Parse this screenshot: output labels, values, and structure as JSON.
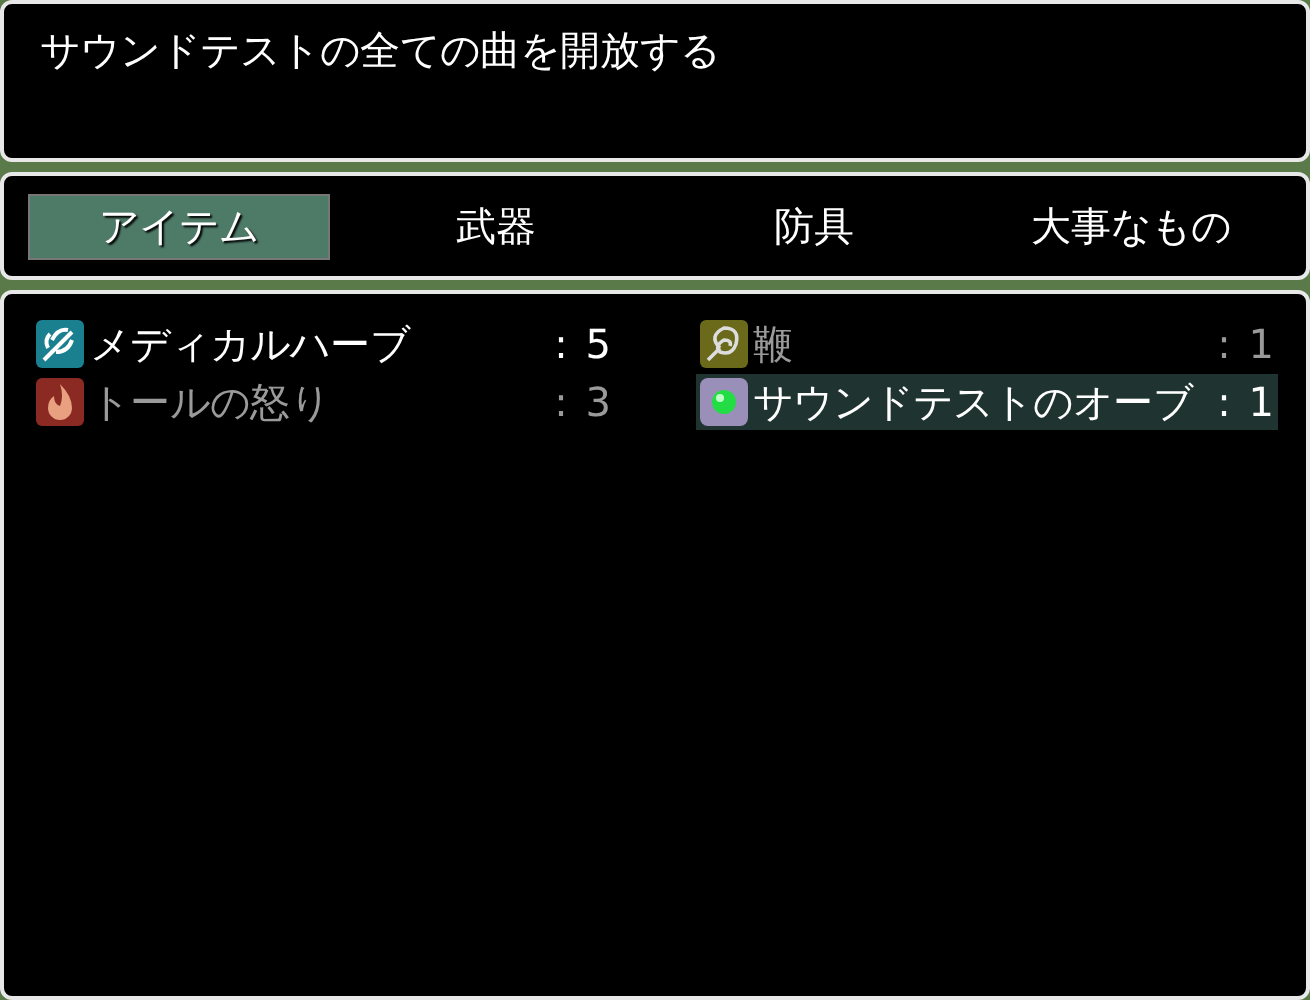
{
  "help": {
    "text": "サウンドテストの全ての曲を開放する"
  },
  "tabs": [
    {
      "label": "アイテム",
      "selected": true
    },
    {
      "label": "武器",
      "selected": false
    },
    {
      "label": "防具",
      "selected": false
    },
    {
      "label": "大事なもの",
      "selected": false
    }
  ],
  "items": [
    {
      "kind": "herb",
      "name": "メディカルハーブ",
      "separator": ":",
      "count": "5",
      "enabled": true,
      "selected": false
    },
    {
      "kind": "whip",
      "name": "鞭",
      "separator": ":",
      "count": "1",
      "enabled": false,
      "selected": false
    },
    {
      "kind": "fire",
      "name": "トールの怒り",
      "separator": ":",
      "count": "3",
      "enabled": false,
      "selected": false
    },
    {
      "kind": "orb",
      "name": "サウンドテストのオーブ",
      "separator": ":",
      "count": "1",
      "enabled": true,
      "selected": true
    }
  ]
}
